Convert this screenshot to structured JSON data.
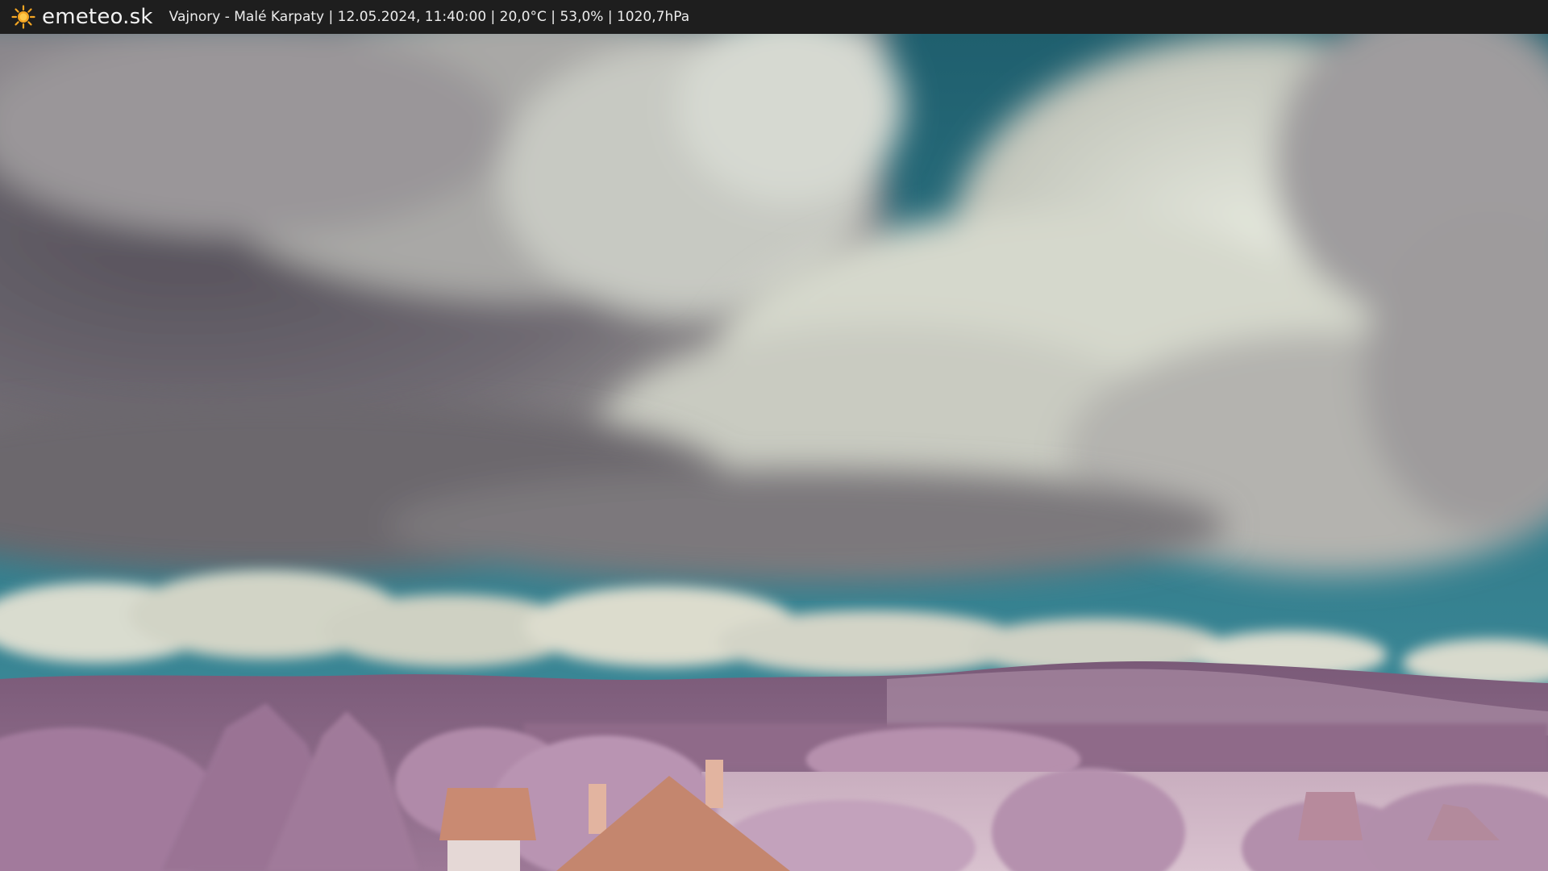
{
  "header": {
    "brand": "emeteo.sk",
    "logo_icon": "sun-icon",
    "info": "Vajnory - Malé Karpaty | 12.05.2024, 11:40:00 | 20,0°C | 53,0% | 1020,7hPa"
  },
  "colors": {
    "bar": "#1e1e1e",
    "sun": "#f5a623",
    "sky": "#2f7080",
    "cloud_dark": "#6e6870",
    "cloud_light": "#d8dccf",
    "hills": "#8c6a86",
    "foliage": "#b98fb3",
    "roof": "#c8806a"
  }
}
